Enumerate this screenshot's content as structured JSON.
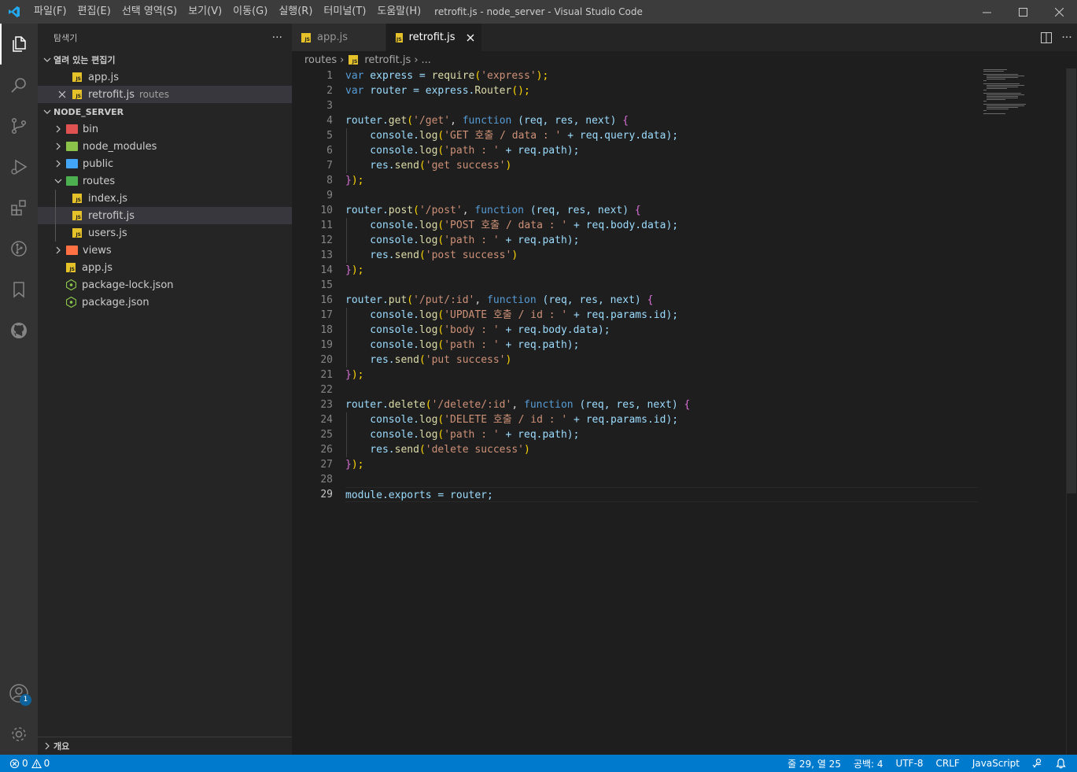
{
  "window": {
    "title": "retrofit.js - node_server - Visual Studio Code",
    "menu": [
      "파일(F)",
      "편집(E)",
      "선택 영역(S)",
      "보기(V)",
      "이동(G)",
      "실행(R)",
      "터미널(T)",
      "도움말(H)"
    ]
  },
  "colors": {
    "accent": "#007acc",
    "activity_bg": "#333333",
    "sidebar_bg": "#252526",
    "editor_bg": "#1e1e1e"
  },
  "sidebar": {
    "title": "탐색기",
    "more": "···",
    "open_editors": {
      "label": "열려 있는 편집기",
      "items": [
        {
          "name": "app.js",
          "desc": ""
        },
        {
          "name": "retrofit.js",
          "desc": "routes"
        }
      ]
    },
    "project": {
      "label": "NODE_SERVER",
      "tree": {
        "bin": "bin",
        "node_modules": "node_modules",
        "public": "public",
        "routes": "routes",
        "index": "index.js",
        "retrofit": "retrofit.js",
        "users": "users.js",
        "views": "views",
        "app": "app.js",
        "package_lock": "package-lock.json",
        "package": "package.json"
      }
    },
    "outline_label": "개요"
  },
  "tabs": [
    {
      "label": "app.js"
    },
    {
      "label": "retrofit.js"
    }
  ],
  "breadcrumb": {
    "folder": "routes",
    "file": "retrofit.js",
    "more": "..."
  },
  "editor": {
    "line_numbers": [
      "1",
      "2",
      "3",
      "4",
      "5",
      "6",
      "7",
      "8",
      "9",
      "10",
      "11",
      "12",
      "13",
      "14",
      "15",
      "16",
      "17",
      "18",
      "19",
      "20",
      "21",
      "22",
      "23",
      "24",
      "25",
      "26",
      "27",
      "28",
      "29"
    ],
    "code": {
      "l1": [
        "var",
        " express = ",
        "require",
        "(",
        "'express'",
        ");"
      ],
      "l2": [
        "var",
        " router = express.",
        "Router",
        "();"
      ],
      "l4": [
        "router.",
        "get",
        "(",
        "'/get'",
        ", ",
        "function",
        " (req, res, next) ",
        "{"
      ],
      "l5": [
        "    console.",
        "log",
        "(",
        "'GET 호출 / data : '",
        " + req.query.data);"
      ],
      "l6": [
        "    console.",
        "log",
        "(",
        "'path : '",
        " + req.path);"
      ],
      "l7": [
        "    res.",
        "send",
        "(",
        "'get success'",
        ")"
      ],
      "l8": [
        "}",
        ");"
      ],
      "l10": [
        "router.",
        "post",
        "(",
        "'/post'",
        ", ",
        "function",
        " (req, res, next) ",
        "{"
      ],
      "l11": [
        "    console.",
        "log",
        "(",
        "'POST 호출 / data : '",
        " + req.body.data);"
      ],
      "l12": [
        "    console.",
        "log",
        "(",
        "'path : '",
        " + req.path);"
      ],
      "l13": [
        "    res.",
        "send",
        "(",
        "'post success'",
        ")"
      ],
      "l14": [
        "}",
        ");"
      ],
      "l16": [
        "router.",
        "put",
        "(",
        "'/put/:id'",
        ", ",
        "function",
        " (req, res, next) ",
        "{"
      ],
      "l17": [
        "    console.",
        "log",
        "(",
        "'UPDATE 호출 / id : '",
        " + req.params.id);"
      ],
      "l18": [
        "    console.",
        "log",
        "(",
        "'body : '",
        " + req.body.data);"
      ],
      "l19": [
        "    console.",
        "log",
        "(",
        "'path : '",
        " + req.path);"
      ],
      "l20": [
        "    res.",
        "send",
        "(",
        "'put success'",
        ")"
      ],
      "l21": [
        "}",
        ");"
      ],
      "l23": [
        "router.",
        "delete",
        "(",
        "'/delete/:id'",
        ", ",
        "function",
        " (req, res, next) ",
        "{"
      ],
      "l24": [
        "    console.",
        "log",
        "(",
        "'DELETE 호출 / id : '",
        " + req.params.id);"
      ],
      "l25": [
        "    console.",
        "log",
        "(",
        "'path : '",
        " + req.path);"
      ],
      "l26": [
        "    res.",
        "send",
        "(",
        "'delete success'",
        ")"
      ],
      "l27": [
        "}",
        ");"
      ],
      "l29": [
        "module.exports = router;"
      ]
    }
  },
  "statusbar": {
    "errors": "0",
    "warnings": "0",
    "position": "줄 29, 열 25",
    "spaces": "공백: 4",
    "encoding": "UTF-8",
    "eol": "CRLF",
    "language": "JavaScript"
  },
  "accounts_badge": "1"
}
